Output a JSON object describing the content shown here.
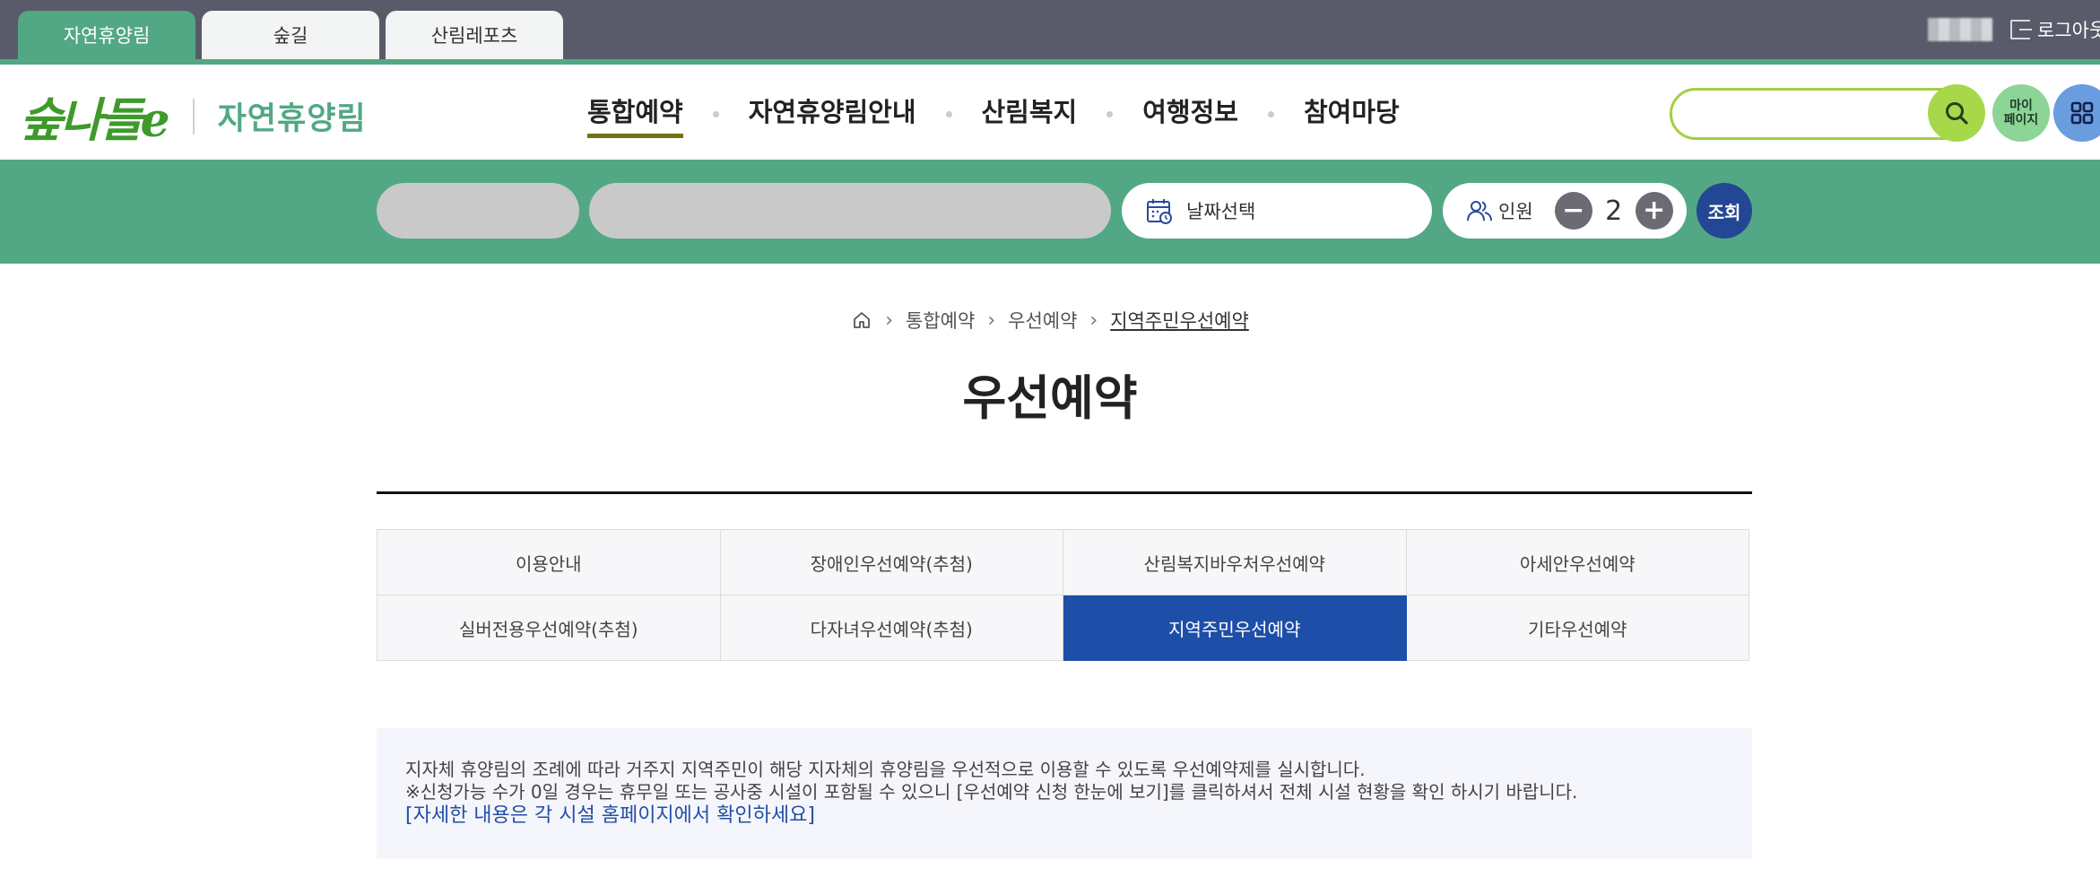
{
  "topbar": {
    "tabs": [
      {
        "label": "자연휴양림",
        "active": true
      },
      {
        "label": "숲길",
        "active": false
      },
      {
        "label": "산림레포츠",
        "active": false
      }
    ],
    "logout_label": "로그아웃"
  },
  "header": {
    "logo_text": "숲나들e",
    "logo_subtitle": "자연휴양림",
    "nav": [
      {
        "label": "통합예약",
        "active": true
      },
      {
        "label": "자연휴양림안내",
        "active": false
      },
      {
        "label": "산림복지",
        "active": false
      },
      {
        "label": "여행정보",
        "active": false
      },
      {
        "label": "참여마당",
        "active": false
      }
    ],
    "mypage_line1": "마이",
    "mypage_line2": "페이지"
  },
  "quick_search": {
    "date_label": "날짜선택",
    "people_label": "인원",
    "people_count": "2",
    "minus": "−",
    "plus": "+",
    "submit_label": "조회"
  },
  "breadcrumb": [
    "통합예약",
    "우선예약",
    "지역주민우선예약"
  ],
  "page_title": "우선예약",
  "tabs": [
    {
      "label": "이용안내",
      "active": false
    },
    {
      "label": "장애인우선예약(추첨)",
      "active": false
    },
    {
      "label": "산림복지바우처우선예약",
      "active": false
    },
    {
      "label": "아세안우선예약",
      "active": false
    },
    {
      "label": "실버전용우선예약(추첨)",
      "active": false
    },
    {
      "label": "다자녀우선예약(추첨)",
      "active": false
    },
    {
      "label": "지역주민우선예약",
      "active": true
    },
    {
      "label": "기타우선예약",
      "active": false
    }
  ],
  "notice": {
    "line1": "지자체 휴양림의 조례에 따라 거주지 지역주민이 해당 지자체의 휴양림을 우선적으로 이용할 수 있도록 우선예약제를 실시합니다.",
    "line2": "※신청가능 수가 0일 경우는 휴무일 또는 공사중 시설이 포함될 수 있으니 [우선예약 신청 한눈에 보기]를 클릭하셔서 전체 시설 현황을 확인 하시기 바랍니다.",
    "link": "[자세한 내용은 각 시설 홈페이지에서 확인하세요]"
  },
  "colors": {
    "brand_green": "#52a884",
    "active_tab_blue": "#1d4ea8",
    "submit_navy": "#244795",
    "topbar_gray": "#595b6a"
  },
  "icons": [
    "home-icon",
    "calendar-icon",
    "people-icon",
    "search-icon",
    "grid-menu-icon",
    "logout-icon"
  ]
}
